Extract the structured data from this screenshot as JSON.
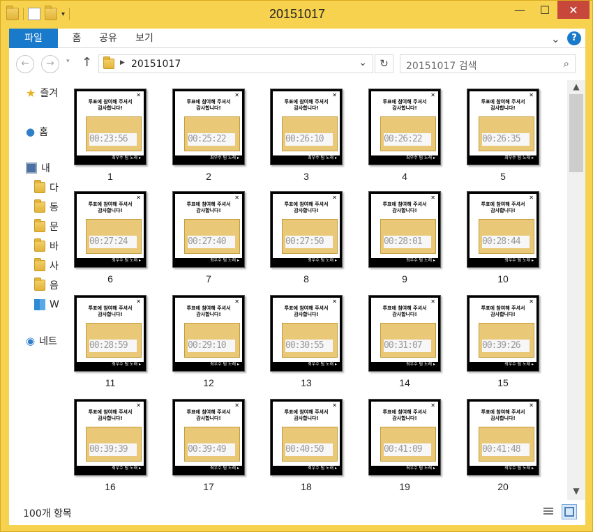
{
  "window": {
    "title": "20151017"
  },
  "ribbon": {
    "tabs": [
      "파일",
      "홈",
      "공유",
      "보기"
    ]
  },
  "address": {
    "path": "20151017"
  },
  "search": {
    "placeholder": "20151017 검색"
  },
  "nav": {
    "items": [
      {
        "label": "즐겨",
        "icon": "star-icon"
      },
      {
        "label": "홈",
        "icon": "homegroup-icon"
      },
      {
        "label": "내",
        "icon": "this-pc-icon"
      },
      {
        "label": "다",
        "icon": "downloads-folder-icon"
      },
      {
        "label": "동",
        "icon": "videos-folder-icon"
      },
      {
        "label": "문",
        "icon": "documents-folder-icon"
      },
      {
        "label": "바",
        "icon": "desktop-folder-icon"
      },
      {
        "label": "사",
        "icon": "pictures-folder-icon"
      },
      {
        "label": "음",
        "icon": "music-folder-icon"
      },
      {
        "label": "W",
        "icon": "windows-drive-icon"
      },
      {
        "label": "네트",
        "icon": "network-icon"
      }
    ]
  },
  "thumbnail_common": {
    "message_line1": "투표에 참여해 주셔서",
    "message_line2": "감사합니다!",
    "footer": "최우수 팀 노래 ▸"
  },
  "files": [
    {
      "label": "1",
      "time": "00:23:56"
    },
    {
      "label": "2",
      "time": "00:25:22"
    },
    {
      "label": "3",
      "time": "00:26:10"
    },
    {
      "label": "4",
      "time": "00:26:22"
    },
    {
      "label": "5",
      "time": "00:26:35"
    },
    {
      "label": "6",
      "time": "00:27:24"
    },
    {
      "label": "7",
      "time": "00:27:40"
    },
    {
      "label": "8",
      "time": "00:27:50"
    },
    {
      "label": "9",
      "time": "00:28:01"
    },
    {
      "label": "10",
      "time": "00:28:44"
    },
    {
      "label": "11",
      "time": "00:28:59"
    },
    {
      "label": "12",
      "time": "00:29:10"
    },
    {
      "label": "13",
      "time": "00:30:55"
    },
    {
      "label": "14",
      "time": "00:31:07"
    },
    {
      "label": "15",
      "time": "00:39:26"
    },
    {
      "label": "16",
      "time": "00:39:39"
    },
    {
      "label": "17",
      "time": "00:39:49"
    },
    {
      "label": "18",
      "time": "00:40:50"
    },
    {
      "label": "19",
      "time": "00:41:09"
    },
    {
      "label": "20",
      "time": "00:41:48"
    }
  ],
  "status": {
    "item_count": "100개 항목"
  },
  "colors": {
    "accent": "#1979ca",
    "frame": "#f6d24f",
    "close": "#c7473a"
  }
}
